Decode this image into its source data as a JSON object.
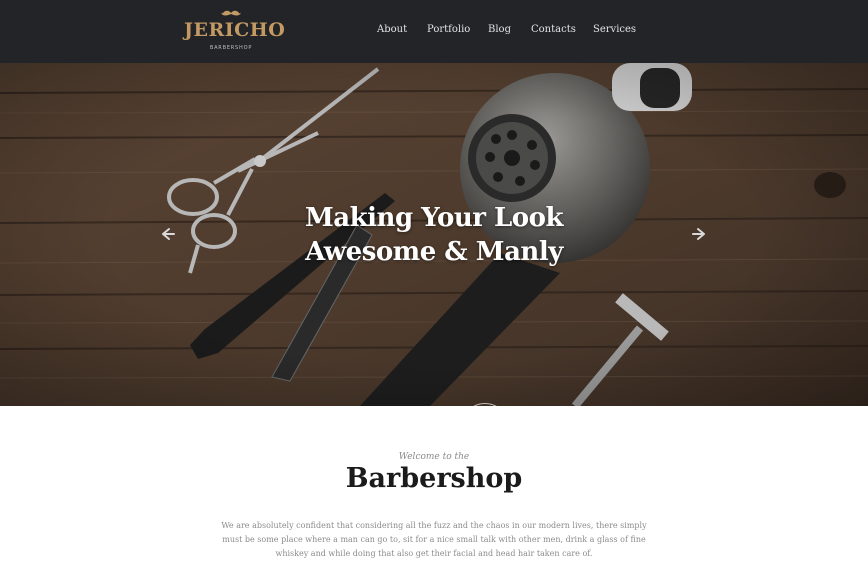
{
  "header": {
    "logo_text": "JERICHO",
    "logo_subtext": "BARBERSHOP",
    "nav": [
      "About",
      "Portfolio",
      "Blog",
      "Contacts",
      "Services"
    ]
  },
  "hero": {
    "title_line1": "Making Your Look",
    "title_line2": "Awesome & Manly",
    "prev_icon": "arrow-left-icon",
    "next_icon": "arrow-right-icon"
  },
  "welcome": {
    "pre_title": "Welcome to the",
    "title": "Barbershop",
    "body": "We are absolutely confident that considering all the fuzz and the chaos in our modern lives, there simply must be some place where a man can go to, sit for a nice small talk with other men, drink a glass of fine whiskey and while doing that also get their facial and head hair taken care of."
  },
  "colors": {
    "header_bg": "#222427",
    "logo_accent": "#c39a63",
    "wood": "#5a4535"
  }
}
